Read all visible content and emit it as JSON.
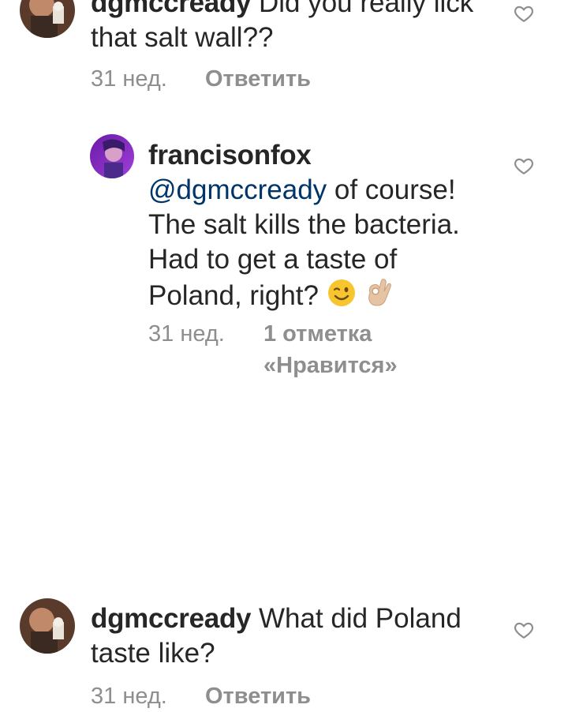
{
  "comments": [
    {
      "username": "dgmccready",
      "text_line1": "Did you really lick",
      "text_line2": "that salt wall??",
      "time": "31 нед.",
      "reply_label": "Ответить"
    },
    {
      "username": "francisonfox",
      "mention": "@dgmccready",
      "text_line1_rest": " of course!",
      "text_line2": "The salt kills the bacteria.",
      "text_line3": "Had to get a taste of",
      "text_line4": "Poland, right?",
      "emoji1": "wink-face",
      "emoji2": "ok-hand",
      "time": "31 нед.",
      "likes_line1": "1 отметка",
      "likes_line2": "«Нравится»"
    },
    {
      "username": "dgmccready",
      "text_line1": "What did Poland",
      "text_line2": "taste like?",
      "time": "31 нед.",
      "reply_label": "Ответить"
    }
  ],
  "colors": {
    "text": "#262626",
    "mention": "#003569",
    "secondary": "#8e8e8e",
    "heart": "#8e8e8e"
  },
  "icons": [
    "heart-icon",
    "avatar"
  ]
}
